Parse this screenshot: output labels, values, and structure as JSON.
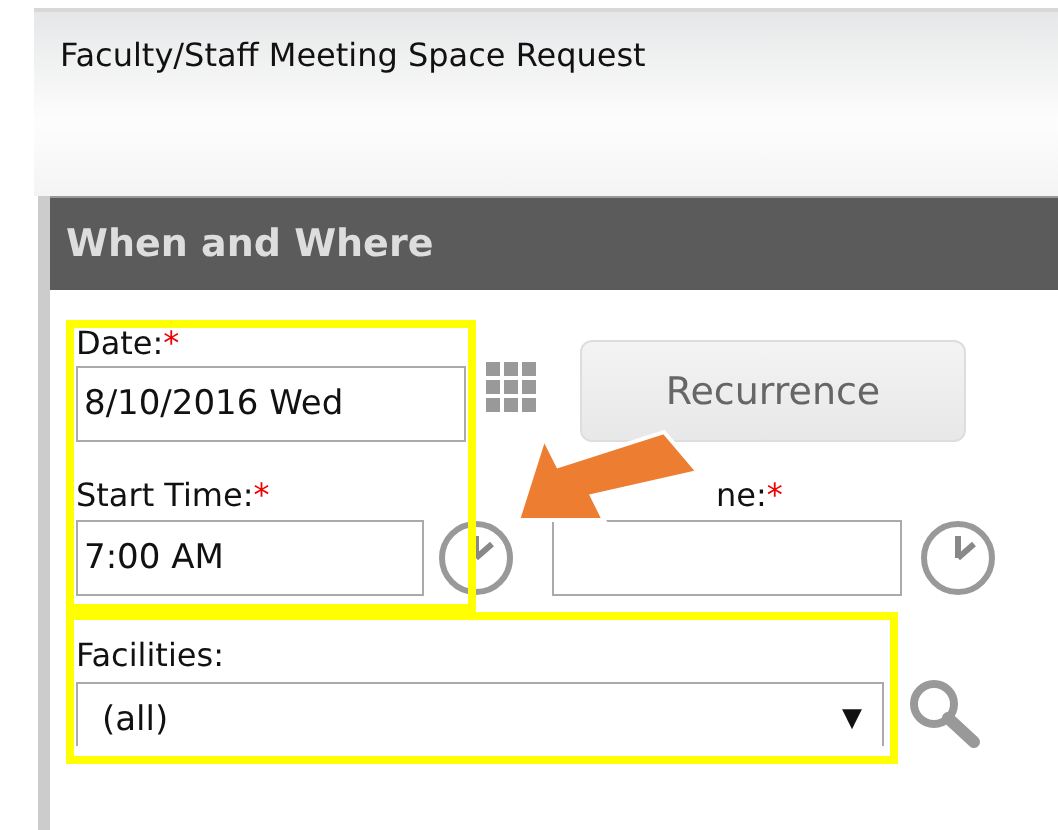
{
  "page_title": "Faculty/Staff Meeting Space Request",
  "panel": {
    "title": "When and Where",
    "required_mark": "*",
    "date": {
      "label": "Date:",
      "required": true,
      "value": "8/10/2016 Wed"
    },
    "recurrence_button": "Recurrence",
    "start_time": {
      "label": "Start Time:",
      "required": true,
      "value": "7:00 AM"
    },
    "end_time": {
      "label_visible": "ne:",
      "required": true
    },
    "facilities": {
      "label": "Facilities:",
      "value": "(all)",
      "caret": "▼"
    }
  }
}
